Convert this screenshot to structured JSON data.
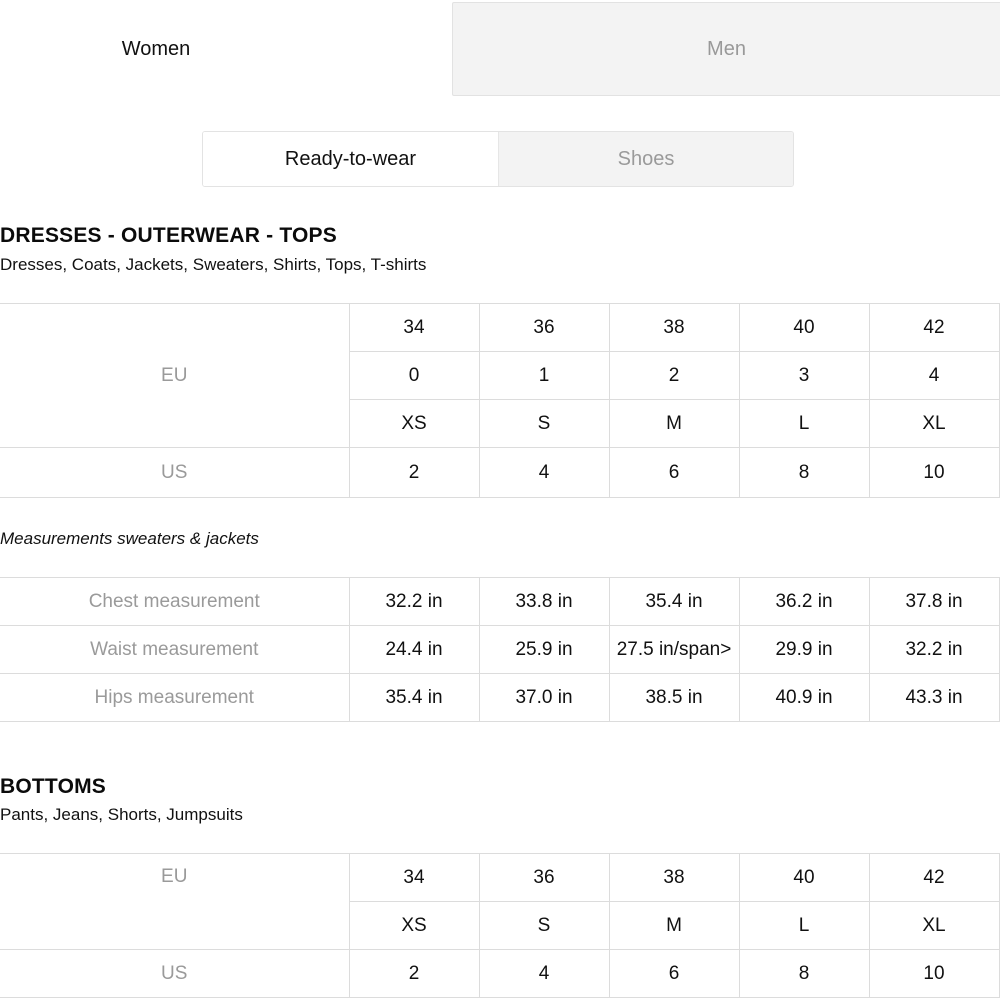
{
  "gender_tabs": {
    "women": "Women",
    "men": "Men"
  },
  "category_tabs": {
    "ready_to_wear": "Ready-to-wear",
    "shoes": "Shoes"
  },
  "tops": {
    "title": "DRESSES - OUTERWEAR - TOPS",
    "subtitle": "Dresses, Coats, Jackets, Sweaters, Shirts, Tops, T-shirts",
    "eu_label": "EU",
    "us_label": "US",
    "eu_rows": [
      [
        "34",
        "36",
        "38",
        "40",
        "42"
      ],
      [
        "0",
        "1",
        "2",
        "3",
        "4"
      ],
      [
        "XS",
        "S",
        "M",
        "L",
        "XL"
      ]
    ],
    "us_row": [
      "2",
      "4",
      "6",
      "8",
      "10"
    ]
  },
  "measurements": {
    "note": "Measurements sweaters & jackets",
    "rows": [
      {
        "label": "Chest measurement",
        "values": [
          "32.2 in",
          "33.8 in",
          "35.4 in",
          "36.2 in",
          "37.8 in"
        ]
      },
      {
        "label": "Waist measurement",
        "values": [
          "24.4 in",
          "25.9 in",
          "27.5 in/span>",
          "29.9 in",
          "32.2 in"
        ]
      },
      {
        "label": "Hips measurement",
        "values": [
          "35.4 in",
          "37.0 in",
          "38.5 in",
          "40.9 in",
          "43.3 in"
        ]
      }
    ]
  },
  "bottoms": {
    "title": "BOTTOMS",
    "subtitle": "Pants, Jeans, Shorts, Jumpsuits",
    "eu_label": "EU",
    "us_label": "US",
    "eu_rows": [
      [
        "34",
        "36",
        "38",
        "40",
        "42"
      ],
      [
        "XS",
        "S",
        "M",
        "L",
        "XL"
      ]
    ],
    "us_row": [
      "2",
      "4",
      "6",
      "8",
      "10"
    ]
  }
}
